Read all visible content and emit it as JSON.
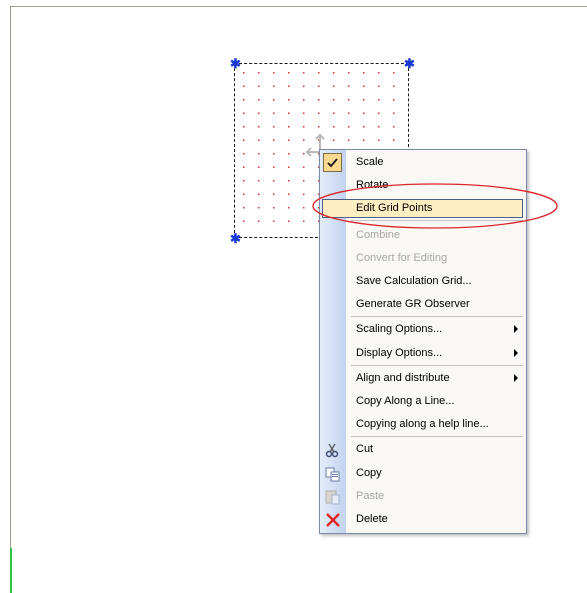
{
  "menu": {
    "items": [
      {
        "label": "Scale",
        "state": "checked",
        "icon": "check-icon"
      },
      {
        "label": "Rotate",
        "state": "normal"
      },
      {
        "label": "Edit Grid Points",
        "state": "highlighted"
      },
      {
        "label": "Combine",
        "state": "disabled"
      },
      {
        "label": "Convert for Editing",
        "state": "disabled"
      },
      {
        "label": "Save Calculation Grid...",
        "state": "normal"
      },
      {
        "label": "Generate GR Observer",
        "state": "normal"
      },
      {
        "label": "Scaling Options...",
        "state": "submenu"
      },
      {
        "label": "Display Options...",
        "state": "submenu"
      },
      {
        "label": "Align and distribute",
        "state": "submenu"
      },
      {
        "label": "Copy Along a Line...",
        "state": "normal"
      },
      {
        "label": "Copying along a help line...",
        "state": "normal"
      },
      {
        "label": "Cut",
        "state": "normal",
        "icon": "scissors-icon"
      },
      {
        "label": "Copy",
        "state": "normal",
        "icon": "copy-icon"
      },
      {
        "label": "Paste",
        "state": "disabled",
        "icon": "paste-icon"
      },
      {
        "label": "Delete",
        "state": "normal",
        "icon": "delete-x-icon"
      }
    ]
  },
  "colors": {
    "handle": "#1a3ad8",
    "grid_point": "#e0302a",
    "annotation_ellipse": "#d9262c",
    "highlight_fill": "#ffeec2"
  }
}
